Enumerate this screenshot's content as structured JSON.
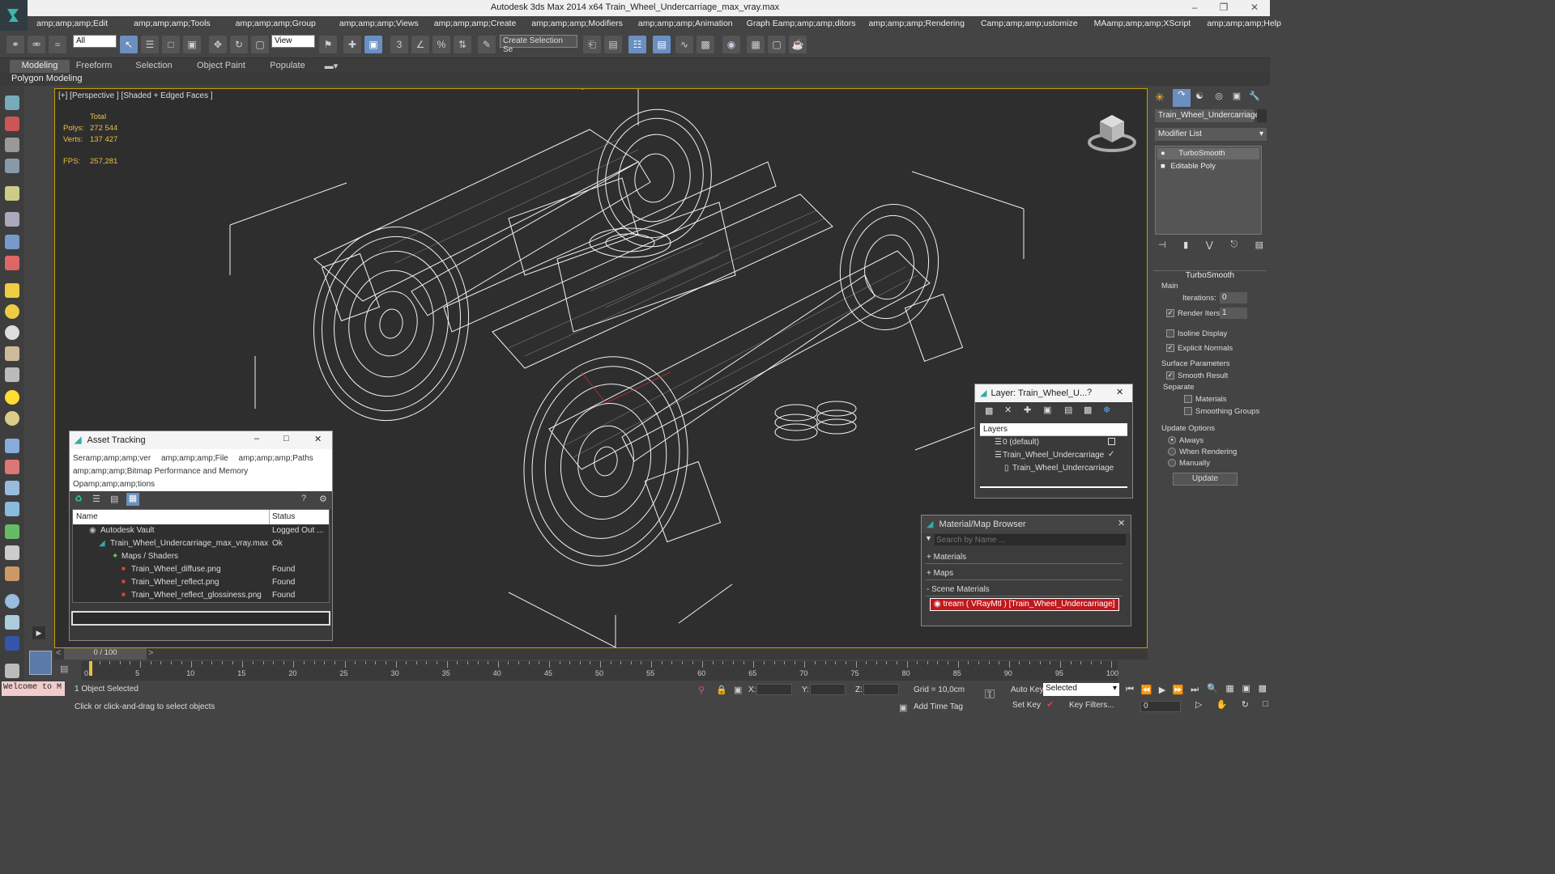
{
  "window": {
    "title": "Autodesk 3ds Max  2014 x64    Train_Wheel_Undercarriage_max_vray.max",
    "minimize": "–",
    "restore": "❐",
    "close": "✕"
  },
  "menu": [
    "amp;amp;amp;Edit",
    "amp;amp;amp;Tools",
    "amp;amp;amp;Group",
    "amp;amp;amp;Views",
    "amp;amp;amp;Create",
    "amp;amp;amp;Modifiers",
    "amp;amp;amp;Animation",
    "Graph Eamp;amp;amp;ditors",
    "amp;amp;amp;Rendering",
    "Camp;amp;amp;ustomize",
    "MAamp;amp;amp;XScript",
    "amp;amp;amp;Help"
  ],
  "toolbar": {
    "selection_filter": "All",
    "ref_coord": "View",
    "named_selection": "Create Selection Se"
  },
  "ribbon": {
    "tabs": [
      "Modeling",
      "Freeform",
      "Selection",
      "Object Paint",
      "Populate"
    ],
    "panel_label": "Polygon Modeling"
  },
  "viewport": {
    "label": "[+] [Perspective ] [Shaded + Edged Faces ]",
    "stats_header": "Total",
    "polys_label": "Polys:",
    "polys_value": "272 544",
    "verts_label": "Verts:",
    "verts_value": "137 427",
    "fps_label": "FPS:",
    "fps_value": "257,281"
  },
  "command_panel": {
    "object_name": "Train_Wheel_Undercarriage",
    "modifier_list": "Modifier List",
    "stack": [
      "TurboSmooth",
      "Editable Poly"
    ],
    "rollout_title": "TurboSmooth",
    "main_label": "Main",
    "iterations_label": "Iterations:",
    "iterations_value": "0",
    "render_iters_label": "Render Iters:",
    "render_iters_value": "1",
    "isoline": "Isoline Display",
    "explicit_normals": "Explicit Normals",
    "surface_params": "Surface Parameters",
    "smooth_result": "Smooth Result",
    "separate": "Separate",
    "materials": "Materials",
    "smoothing_groups": "Smoothing Groups",
    "update_options": "Update Options",
    "always": "Always",
    "when_rendering": "When Rendering",
    "manually": "Manually",
    "update_btn": "Update"
  },
  "asset_tracking": {
    "title": "Asset Tracking",
    "menu_line1": [
      "Seramp;amp;amp;ver",
      "amp;amp;amp;File",
      "amp;amp;amp;Paths"
    ],
    "menu_line2": "amp;amp;amp;Bitmap Performance and Memory",
    "menu_line3": "Opamp;amp;amp;tions",
    "col_name": "Name",
    "col_status": "Status",
    "rows": [
      {
        "name": "Autodesk Vault",
        "status": "Logged Out ..."
      },
      {
        "name": "Train_Wheel_Undercarriage_max_vray.max",
        "status": "Ok"
      },
      {
        "name": "Maps / Shaders",
        "status": ""
      },
      {
        "name": "Train_Wheel_diffuse.png",
        "status": "Found"
      },
      {
        "name": "Train_Wheel_reflect.png",
        "status": "Found"
      },
      {
        "name": "Train_Wheel_reflect_glossiness.png",
        "status": "Found"
      }
    ]
  },
  "layer_window": {
    "title": "Layer: Train_Wheel_U...",
    "help": "?",
    "header": "Layers",
    "rows": [
      "0 (default)",
      "Train_Wheel_Undercarriage",
      "Train_Wheel_Undercarriage"
    ]
  },
  "material_browser": {
    "title": "Material/Map Browser",
    "search_placeholder": "Search by Name ...",
    "sections": [
      "+ Materials",
      "+ Maps",
      "- Scene Materials"
    ],
    "scene_material": "tream ( VRayMtl ) [Train_Wheel_Undercarriage]"
  },
  "timeline": {
    "frame": "0 / 100",
    "ticks": [
      "0",
      "5",
      "10",
      "15",
      "20",
      "25",
      "30",
      "35",
      "40",
      "45",
      "50",
      "55",
      "60",
      "65",
      "70",
      "75",
      "80",
      "85",
      "90",
      "95",
      "100"
    ]
  },
  "status": {
    "maxscript": "Welcome to M",
    "selected": "1 Object Selected",
    "prompt": "Click or click-and-drag to select objects",
    "x_label": "X:",
    "y_label": "Y:",
    "z_label": "Z:",
    "grid": "Grid = 10,0cm",
    "auto_key": "Auto Key",
    "set_key": "Set Key",
    "key_mode": "Selected",
    "key_filters": "Key Filters...",
    "add_time_tag": "Add Time Tag",
    "frame_value": "0"
  },
  "colors": {
    "accent": "#6a8fc0",
    "viewport_border": "#c8a000",
    "stats": "#e8c040",
    "scene_material_bg": "#c0181c"
  }
}
